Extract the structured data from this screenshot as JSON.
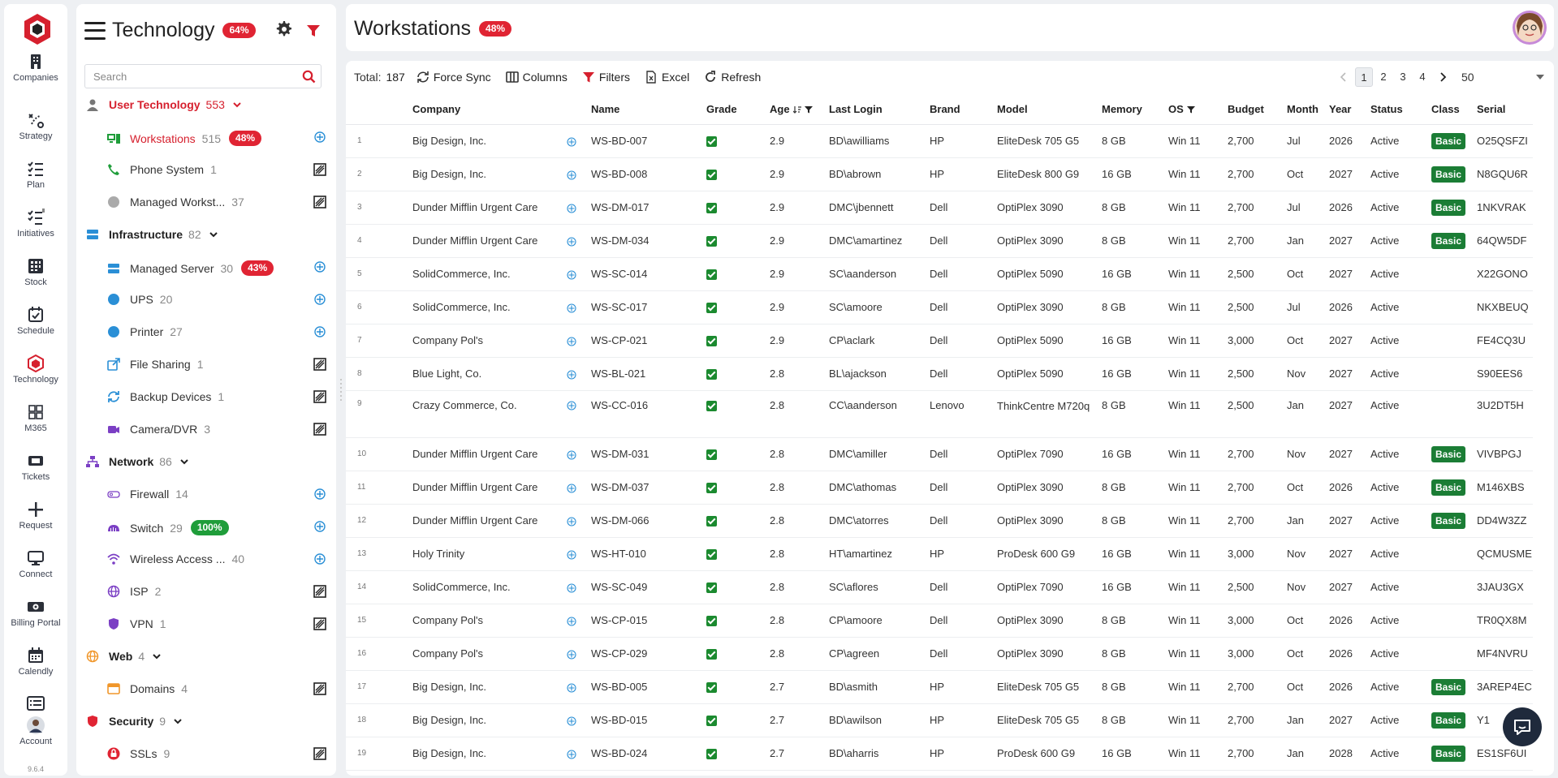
{
  "rail": {
    "items": [
      {
        "label": "Companies",
        "icon": "building-icon"
      },
      {
        "label": "Strategy",
        "icon": "strategy-icon"
      },
      {
        "label": "Plan",
        "icon": "checklist-icon"
      },
      {
        "label": "Initiatives",
        "icon": "initiatives-icon"
      },
      {
        "label": "Stock",
        "icon": "grid-icon"
      },
      {
        "label": "Schedule",
        "icon": "calendar-check-icon"
      },
      {
        "label": "Technology",
        "icon": "hexagon-icon"
      },
      {
        "label": "M365",
        "icon": "office-icon"
      },
      {
        "label": "Tickets",
        "icon": "ticket-icon"
      },
      {
        "label": "Request",
        "icon": "plus-icon"
      },
      {
        "label": "Connect",
        "icon": "monitor-icon"
      },
      {
        "label": "Billing Portal",
        "icon": "cash-icon"
      },
      {
        "label": "Calendly",
        "icon": "calendar-icon"
      },
      {
        "label": "Account",
        "icon": "list-icon"
      }
    ],
    "version": "9.6.4"
  },
  "panel": {
    "title": "Technology",
    "title_badge": "64%",
    "search_placeholder": "Search",
    "categories": [
      {
        "name": "User Technology",
        "count": "553"
      },
      {
        "name": "Infrastructure",
        "count": "82"
      },
      {
        "name": "Network",
        "count": "86"
      },
      {
        "name": "Web",
        "count": "4"
      },
      {
        "name": "Security",
        "count": "9"
      }
    ],
    "items": [
      {
        "name": "Workstations",
        "count": "515",
        "badge": "48%"
      },
      {
        "name": "Phone System",
        "count": "1"
      },
      {
        "name": "Managed Workst...",
        "count": "37"
      },
      {
        "name": "Managed Server",
        "count": "30",
        "badge": "43%"
      },
      {
        "name": "UPS",
        "count": "20"
      },
      {
        "name": "Printer",
        "count": "27"
      },
      {
        "name": "File Sharing",
        "count": "1"
      },
      {
        "name": "Backup Devices",
        "count": "1"
      },
      {
        "name": "Camera/DVR",
        "count": "3"
      },
      {
        "name": "Firewall",
        "count": "14"
      },
      {
        "name": "Switch",
        "count": "29",
        "badge": "100%"
      },
      {
        "name": "Wireless Access ...",
        "count": "40"
      },
      {
        "name": "ISP",
        "count": "2"
      },
      {
        "name": "VPN",
        "count": "1"
      },
      {
        "name": "Domains",
        "count": "4"
      },
      {
        "name": "SSLs",
        "count": "9"
      }
    ]
  },
  "header": {
    "title": "Workstations",
    "badge": "48%"
  },
  "toolbar": {
    "total_label": "Total:",
    "total_value": "187",
    "force_sync": "Force Sync",
    "columns": "Columns",
    "filters": "Filters",
    "excel": "Excel",
    "refresh": "Refresh"
  },
  "pager": {
    "pages": [
      "1",
      "2",
      "3",
      "4"
    ],
    "current": "1",
    "page_size": "50"
  },
  "table": {
    "columns": [
      "Company",
      "Name",
      "Grade",
      "Age",
      "Last Login",
      "Brand",
      "Model",
      "Memory",
      "OS",
      "Budget",
      "Month",
      "Year",
      "Status",
      "Class",
      "Serial"
    ],
    "rows": [
      [
        "1",
        "Big Design, Inc.",
        "WS-BD-007",
        "2.9",
        "BD\\awilliams",
        "HP",
        "EliteDesk 705 G5",
        "8 GB",
        "Win 11",
        "2,700",
        "Jul",
        "2026",
        "Active",
        "Basic",
        "O25QSFZI"
      ],
      [
        "2",
        "Big Design, Inc.",
        "WS-BD-008",
        "2.9",
        "BD\\abrown",
        "HP",
        "EliteDesk 800 G9",
        "16 GB",
        "Win 11",
        "2,700",
        "Oct",
        "2027",
        "Active",
        "Basic",
        "N8GQU6R"
      ],
      [
        "3",
        "Dunder Mifflin Urgent Care",
        "WS-DM-017",
        "2.9",
        "DMC\\jbennett",
        "Dell",
        "OptiPlex 3090",
        "8 GB",
        "Win 11",
        "2,700",
        "Jul",
        "2026",
        "Active",
        "Basic",
        "1NKVRAK"
      ],
      [
        "4",
        "Dunder Mifflin Urgent Care",
        "WS-DM-034",
        "2.9",
        "DMC\\amartinez",
        "Dell",
        "OptiPlex 3090",
        "8 GB",
        "Win 11",
        "2,700",
        "Jan",
        "2027",
        "Active",
        "Basic",
        "64QW5DF"
      ],
      [
        "5",
        "SolidCommerce, Inc.",
        "WS-SC-014",
        "2.9",
        "SC\\aanderson",
        "Dell",
        "OptiPlex 5090",
        "16 GB",
        "Win 11",
        "2,500",
        "Oct",
        "2027",
        "Active",
        "",
        "X22GONO"
      ],
      [
        "6",
        "SolidCommerce, Inc.",
        "WS-SC-017",
        "2.9",
        "SC\\amoore",
        "Dell",
        "OptiPlex 3090",
        "8 GB",
        "Win 11",
        "2,500",
        "Jul",
        "2026",
        "Active",
        "",
        "NKXBEUQ"
      ],
      [
        "7",
        "Company Pol's",
        "WS-CP-021",
        "2.9",
        "CP\\aclark",
        "Dell",
        "OptiPlex 5090",
        "16 GB",
        "Win 11",
        "3,000",
        "Oct",
        "2027",
        "Active",
        "",
        "FE4CQ3U"
      ],
      [
        "8",
        "Blue Light, Co.",
        "WS-BL-021",
        "2.8",
        "BL\\ajackson",
        "Dell",
        "OptiPlex 5090",
        "16 GB",
        "Win 11",
        "2,500",
        "Nov",
        "2027",
        "Active",
        "",
        "S90EES6"
      ],
      [
        "9",
        "Crazy Commerce, Co.",
        "WS-CC-016",
        "2.8",
        "CC\\aanderson",
        "Lenovo",
        "ThinkCentre M720q",
        "8 GB",
        "Win 11",
        "2,500",
        "Jan",
        "2027",
        "Active",
        "",
        "3U2DT5H"
      ],
      [
        "10",
        "Dunder Mifflin Urgent Care",
        "WS-DM-031",
        "2.8",
        "DMC\\amiller",
        "Dell",
        "OptiPlex 7090",
        "16 GB",
        "Win 11",
        "2,700",
        "Nov",
        "2027",
        "Active",
        "Basic",
        "VIVBPGJ"
      ],
      [
        "11",
        "Dunder Mifflin Urgent Care",
        "WS-DM-037",
        "2.8",
        "DMC\\athomas",
        "Dell",
        "OptiPlex 3090",
        "8 GB",
        "Win 11",
        "2,700",
        "Oct",
        "2026",
        "Active",
        "Basic",
        "M146XBS"
      ],
      [
        "12",
        "Dunder Mifflin Urgent Care",
        "WS-DM-066",
        "2.8",
        "DMC\\atorres",
        "Dell",
        "OptiPlex 3090",
        "8 GB",
        "Win 11",
        "2,700",
        "Jan",
        "2027",
        "Active",
        "Basic",
        "DD4W3ZZ"
      ],
      [
        "13",
        "Holy Trinity",
        "WS-HT-010",
        "2.8",
        "HT\\amartinez",
        "HP",
        "ProDesk 600 G9",
        "16 GB",
        "Win 11",
        "3,000",
        "Nov",
        "2027",
        "Active",
        "",
        "QCMUSME"
      ],
      [
        "14",
        "SolidCommerce, Inc.",
        "WS-SC-049",
        "2.8",
        "SC\\aflores",
        "Dell",
        "OptiPlex 7090",
        "16 GB",
        "Win 11",
        "2,500",
        "Nov",
        "2027",
        "Active",
        "",
        "3JAU3GX"
      ],
      [
        "15",
        "Company Pol's",
        "WS-CP-015",
        "2.8",
        "CP\\amoore",
        "Dell",
        "OptiPlex 3090",
        "8 GB",
        "Win 11",
        "3,000",
        "Oct",
        "2026",
        "Active",
        "",
        "TR0QX8M"
      ],
      [
        "16",
        "Company Pol's",
        "WS-CP-029",
        "2.8",
        "CP\\agreen",
        "Dell",
        "OptiPlex 3090",
        "8 GB",
        "Win 11",
        "3,000",
        "Oct",
        "2026",
        "Active",
        "",
        "MF4NVRU"
      ],
      [
        "17",
        "Big Design, Inc.",
        "WS-BD-005",
        "2.7",
        "BD\\asmith",
        "HP",
        "EliteDesk 705 G5",
        "8 GB",
        "Win 11",
        "2,700",
        "Oct",
        "2026",
        "Active",
        "Basic",
        "3AREP4EC"
      ],
      [
        "18",
        "Big Design, Inc.",
        "WS-BD-015",
        "2.7",
        "BD\\awilson",
        "HP",
        "EliteDesk 705 G5",
        "8 GB",
        "Win 11",
        "2,700",
        "Jan",
        "2027",
        "Active",
        "Basic",
        "Y1"
      ],
      [
        "19",
        "Big Design, Inc.",
        "WS-BD-024",
        "2.7",
        "BD\\aharris",
        "HP",
        "ProDesk 600 G9",
        "16 GB",
        "Win 11",
        "2,700",
        "Jan",
        "2028",
        "Active",
        "Basic",
        "ES1SF6UI"
      ]
    ]
  },
  "colors": {
    "accent": "#d6202e",
    "badge_red": "#e02433",
    "badge_green": "#1f9d3a",
    "class_green": "#1b7d35"
  }
}
